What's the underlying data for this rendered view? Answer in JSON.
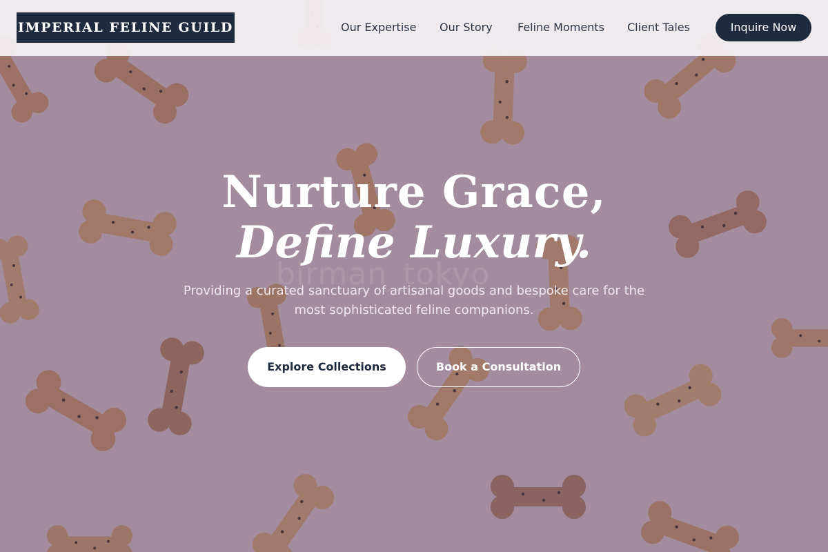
{
  "brand": {
    "name": "IMPERIAL FELINE GUILD"
  },
  "nav": {
    "links": [
      {
        "label": "Our Expertise"
      },
      {
        "label": "Our Story"
      },
      {
        "label": "Feline Moments"
      },
      {
        "label": "Client Tales"
      }
    ],
    "cta_label": "Inquire Now"
  },
  "hero": {
    "title_line1": "Nurture Grace,",
    "title_line2": "Define Luxury.",
    "subtitle": "Providing a curated sanctuary of artisanal goods and bespoke care for the most sophisticated feline companions.",
    "primary_button": "Explore Collections",
    "secondary_button": "Book a Consultation",
    "background_watermark": "birman_tokyo",
    "background_image": "dog-bone-biscuits-on-pink"
  },
  "colors": {
    "navy": "#1e2a3e",
    "overlay": "#5c4260",
    "nav_background": "#f4f1f4",
    "biscuit": "#c9966a"
  }
}
